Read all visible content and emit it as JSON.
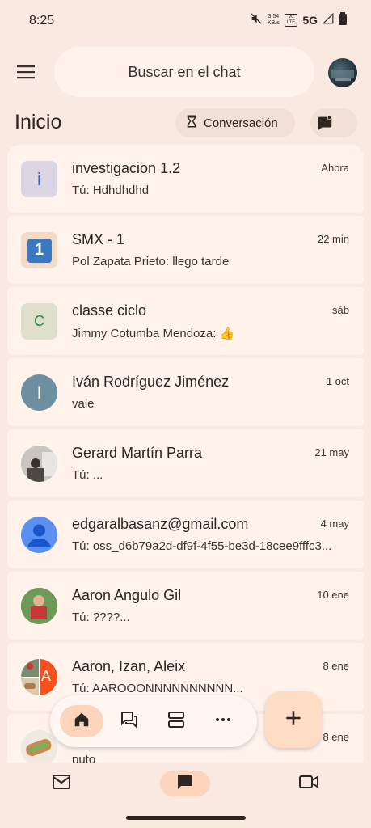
{
  "status": {
    "time": "8:25",
    "speed_value": "3.54",
    "speed_unit": "KB/s",
    "volte_top": "Vo",
    "volte_bottom": "LTE",
    "network": "5G"
  },
  "header": {
    "search_placeholder": "Buscar en el chat",
    "title": "Inicio",
    "chip_label": "Conversación"
  },
  "chats": [
    {
      "name": "investigacion 1.2",
      "preview": "Tú: Hdhdhdhd",
      "time": "Ahora",
      "avatar_letter": "i"
    },
    {
      "name": "SMX - 1",
      "preview": "Pol Zapata Prieto: llego tarde",
      "time": "22 min",
      "avatar_letter": "1"
    },
    {
      "name": "classe ciclo",
      "preview": "Jimmy Cotumba Mendoza: 👍",
      "time": "sáb",
      "avatar_letter": "C"
    },
    {
      "name": "Iván Rodríguez Jiménez",
      "preview": "vale",
      "time": "1 oct",
      "avatar_letter": "I"
    },
    {
      "name": "Gerard Martín Parra",
      "preview": "Tú: ...",
      "time": "21 may",
      "avatar_letter": ""
    },
    {
      "name": "edgaralbasanz@gmail.com",
      "preview": "Tú: oss_d6b79a2d-df9f-4f55-be3d-18cee9fffc3...",
      "time": "4 may",
      "avatar_letter": ""
    },
    {
      "name": "Aaron Angulo Gil",
      "preview": "Tú: ????...",
      "time": "10 ene",
      "avatar_letter": ""
    },
    {
      "name": "Aaron, Izan, Aleix",
      "preview": "Tú: AAROOONNNNNNNNNN...",
      "time": "8 ene",
      "avatar_letter": "A"
    },
    {
      "name": "",
      "preview": "puto",
      "time": "8 ene",
      "avatar_letter": ""
    }
  ],
  "colors": {
    "background": "#f9e9e0",
    "card": "#fff3ec",
    "accent": "#fdd5bd",
    "fab": "#ffdcc4"
  },
  "icons": {
    "menu": "menu-icon",
    "home": "home-icon",
    "chats": "forum-icon",
    "spaces": "view-agenda-icon",
    "more": "more-horiz-icon",
    "add": "plus-icon",
    "mail": "mail-icon",
    "chat": "chat-icon",
    "video": "video-icon"
  }
}
